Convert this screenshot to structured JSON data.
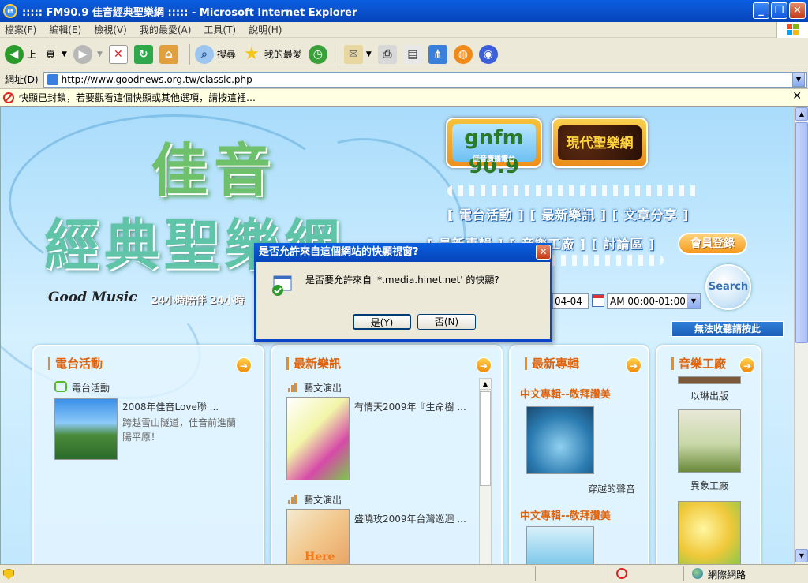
{
  "window": {
    "title": "::::: FM90.9 佳音經典聖樂網 ::::: - Microsoft Internet Explorer"
  },
  "menu": [
    "檔案(F)",
    "編輯(E)",
    "檢視(V)",
    "我的最愛(A)",
    "工具(T)",
    "說明(H)"
  ],
  "toolbar": {
    "back": "上一頁",
    "search": "搜尋",
    "favorites": "我的最愛"
  },
  "address": {
    "label": "網址(D)",
    "url": "http://www.goodnews.org.tw/classic.php"
  },
  "infobar": {
    "text": "快顯已封鎖，若要觀看這個快顯或其他選項，請按這裡…"
  },
  "banner": {
    "title_top": "佳音",
    "title_bottom": "經典聖樂網",
    "good_music": "Good Music",
    "hours": "24小時陪伴 24小時",
    "logo_fm": "gnfm 90.9",
    "logo_fm_sub": "佳音廣播電台",
    "logo_modern": "現代聖樂網",
    "nav1": "[ 電台活動 ] [ 最新樂訊 ] [ 文章分享 ]",
    "nav2": "[ 最新專輯 ] [ 音樂工廠 ] [ 討論區 ]",
    "member": "會員登錄",
    "search": "Search",
    "date": "04-04",
    "time": "AM 00:00-01:00",
    "nosave": "無法收聽請按此"
  },
  "panels": {
    "radio": {
      "title": "電台活動",
      "sub": "電台活動",
      "item_title": "2008年佳音Love聯 ...",
      "item_desc": "跨越雪山隧道，佳音前進蘭陽平原！"
    },
    "news": {
      "title": "最新樂訊",
      "cat1": "藝文演出",
      "item1": "有情天2009年『生命樹 ...",
      "cat2": "藝文演出",
      "item2": "盛曉玫2009年台灣巡迴 ...",
      "img2_text": "Here"
    },
    "albums": {
      "title": "最新專輯",
      "cat1": "中文專輯--敬拜讚美",
      "album1": "穿越的聲音",
      "cat2": "中文專輯--敬拜讚美"
    },
    "factory": {
      "title": "音樂工廠",
      "item1": "以琳出版",
      "item2": "異象工廠"
    }
  },
  "dialog": {
    "title": "是否允許來自這個網站的快顯視窗?",
    "message": "是否要允許來自 '*.media.hinet.net' 的快顯?",
    "yes": "是(Y)",
    "no": "否(N)"
  },
  "status": {
    "zone": "網際網路"
  }
}
